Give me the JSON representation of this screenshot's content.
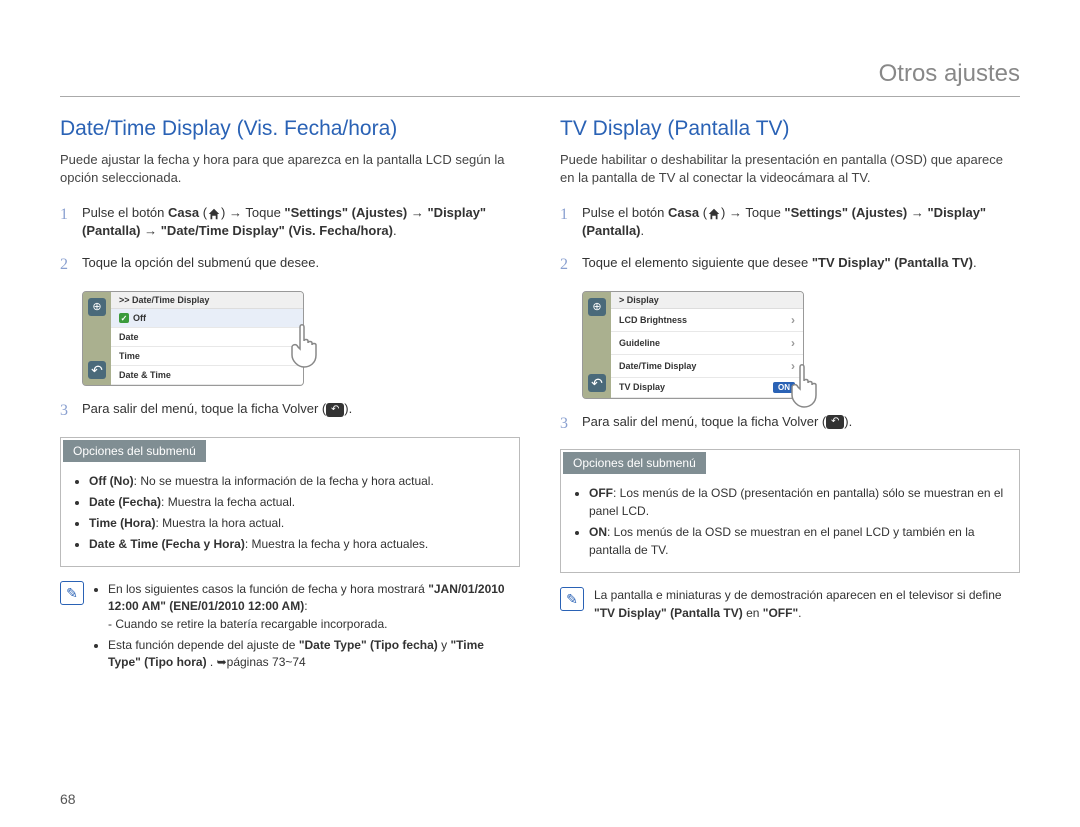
{
  "section_title": "Otros ajustes",
  "page_number": "68",
  "left": {
    "title": "Date/Time Display (Vis. Fecha/hora)",
    "intro": "Puede ajustar la fecha y hora para que aparezca en la pantalla LCD según la opción seleccionada.",
    "steps": {
      "s1": {
        "pre": "Pulse el botón ",
        "casa": "Casa",
        "arrow1": " → Toque ",
        "settings": "\"Settings\" (Ajustes)",
        "arrow2": " → ",
        "display": "\"Display\" (Pantalla)",
        "arrow3": " → ",
        "datetime": "\"Date/Time Display\" (Vis. Fecha/hora)",
        "period": "."
      },
      "s2": "Toque la opción del submenú que desee.",
      "s3": {
        "pre": "Para salir del menú, toque la ficha Volver (",
        "post": ")."
      }
    },
    "lcd": {
      "header": ">> Date/Time Display",
      "rows": [
        "Off",
        "Date",
        "Time",
        "Date & Time"
      ]
    },
    "subopt_title": "Opciones del submenú",
    "subopt": {
      "off_b": "Off (No)",
      "off_t": ": No se muestra la información de la fecha y hora actual.",
      "date_b": "Date (Fecha)",
      "date_t": ": Muestra la fecha actual.",
      "time_b": "Time (Hora)",
      "time_t": ": Muestra la hora actual.",
      "dt_b": "Date & Time (Fecha y Hora)",
      "dt_t": ": Muestra la fecha y hora actuales."
    },
    "note": {
      "n1_pre": "En los siguientes casos la función de fecha y hora mostrará ",
      "n1_bold": "\"JAN/01/2010 12:00 AM\" (ENE/01/2010 12:00 AM)",
      "n1_post": ":",
      "n1_sub": "- Cuando se retire la batería recargable incorporada.",
      "n2_pre": "Esta función depende del ajuste de ",
      "n2_b1": "\"Date Type\" (Tipo fecha)",
      "n2_mid": " y ",
      "n2_b2": "\"Time Type\" (Tipo hora)",
      "n2_post": ". ➥páginas 73~74"
    }
  },
  "right": {
    "title": "TV Display (Pantalla TV)",
    "intro": "Puede habilitar o deshabilitar la presentación en pantalla (OSD) que aparece en la pantalla de TV al conectar la videocámara al TV.",
    "steps": {
      "s1": {
        "pre": "Pulse el botón ",
        "casa": "Casa",
        "arrow1": " → Toque ",
        "settings": "\"Settings\" (Ajustes)",
        "arrow2": " → ",
        "display": "\"Display\" (Pantalla)",
        "period": "."
      },
      "s2_pre": "Toque el elemento siguiente que desee ",
      "s2_bold": "\"TV Display\" (Pantalla TV)",
      "s2_post": ".",
      "s3": {
        "pre": "Para salir del menú, toque la ficha Volver (",
        "post": ")."
      }
    },
    "lcd": {
      "header": "> Display",
      "rows": [
        "LCD Brightness",
        "Guideline",
        "Date/Time Display",
        "TV Display"
      ],
      "on": "ON"
    },
    "subopt_title": "Opciones del submenú",
    "subopt": {
      "off_b": "OFF",
      "off_t": ": Los menús de la OSD (presentación en pantalla) sólo se muestran en el panel LCD.",
      "on_b": "ON",
      "on_t": ": Los menús de la OSD se muestran en el panel LCD y también en la pantalla de TV."
    },
    "note": {
      "pre": "La pantalla e miniaturas y de demostración aparecen en el televisor si define ",
      "bold": "\"TV Display\" (Pantalla TV)",
      "mid": " en ",
      "bold2": "\"OFF\"",
      "post": "."
    }
  }
}
